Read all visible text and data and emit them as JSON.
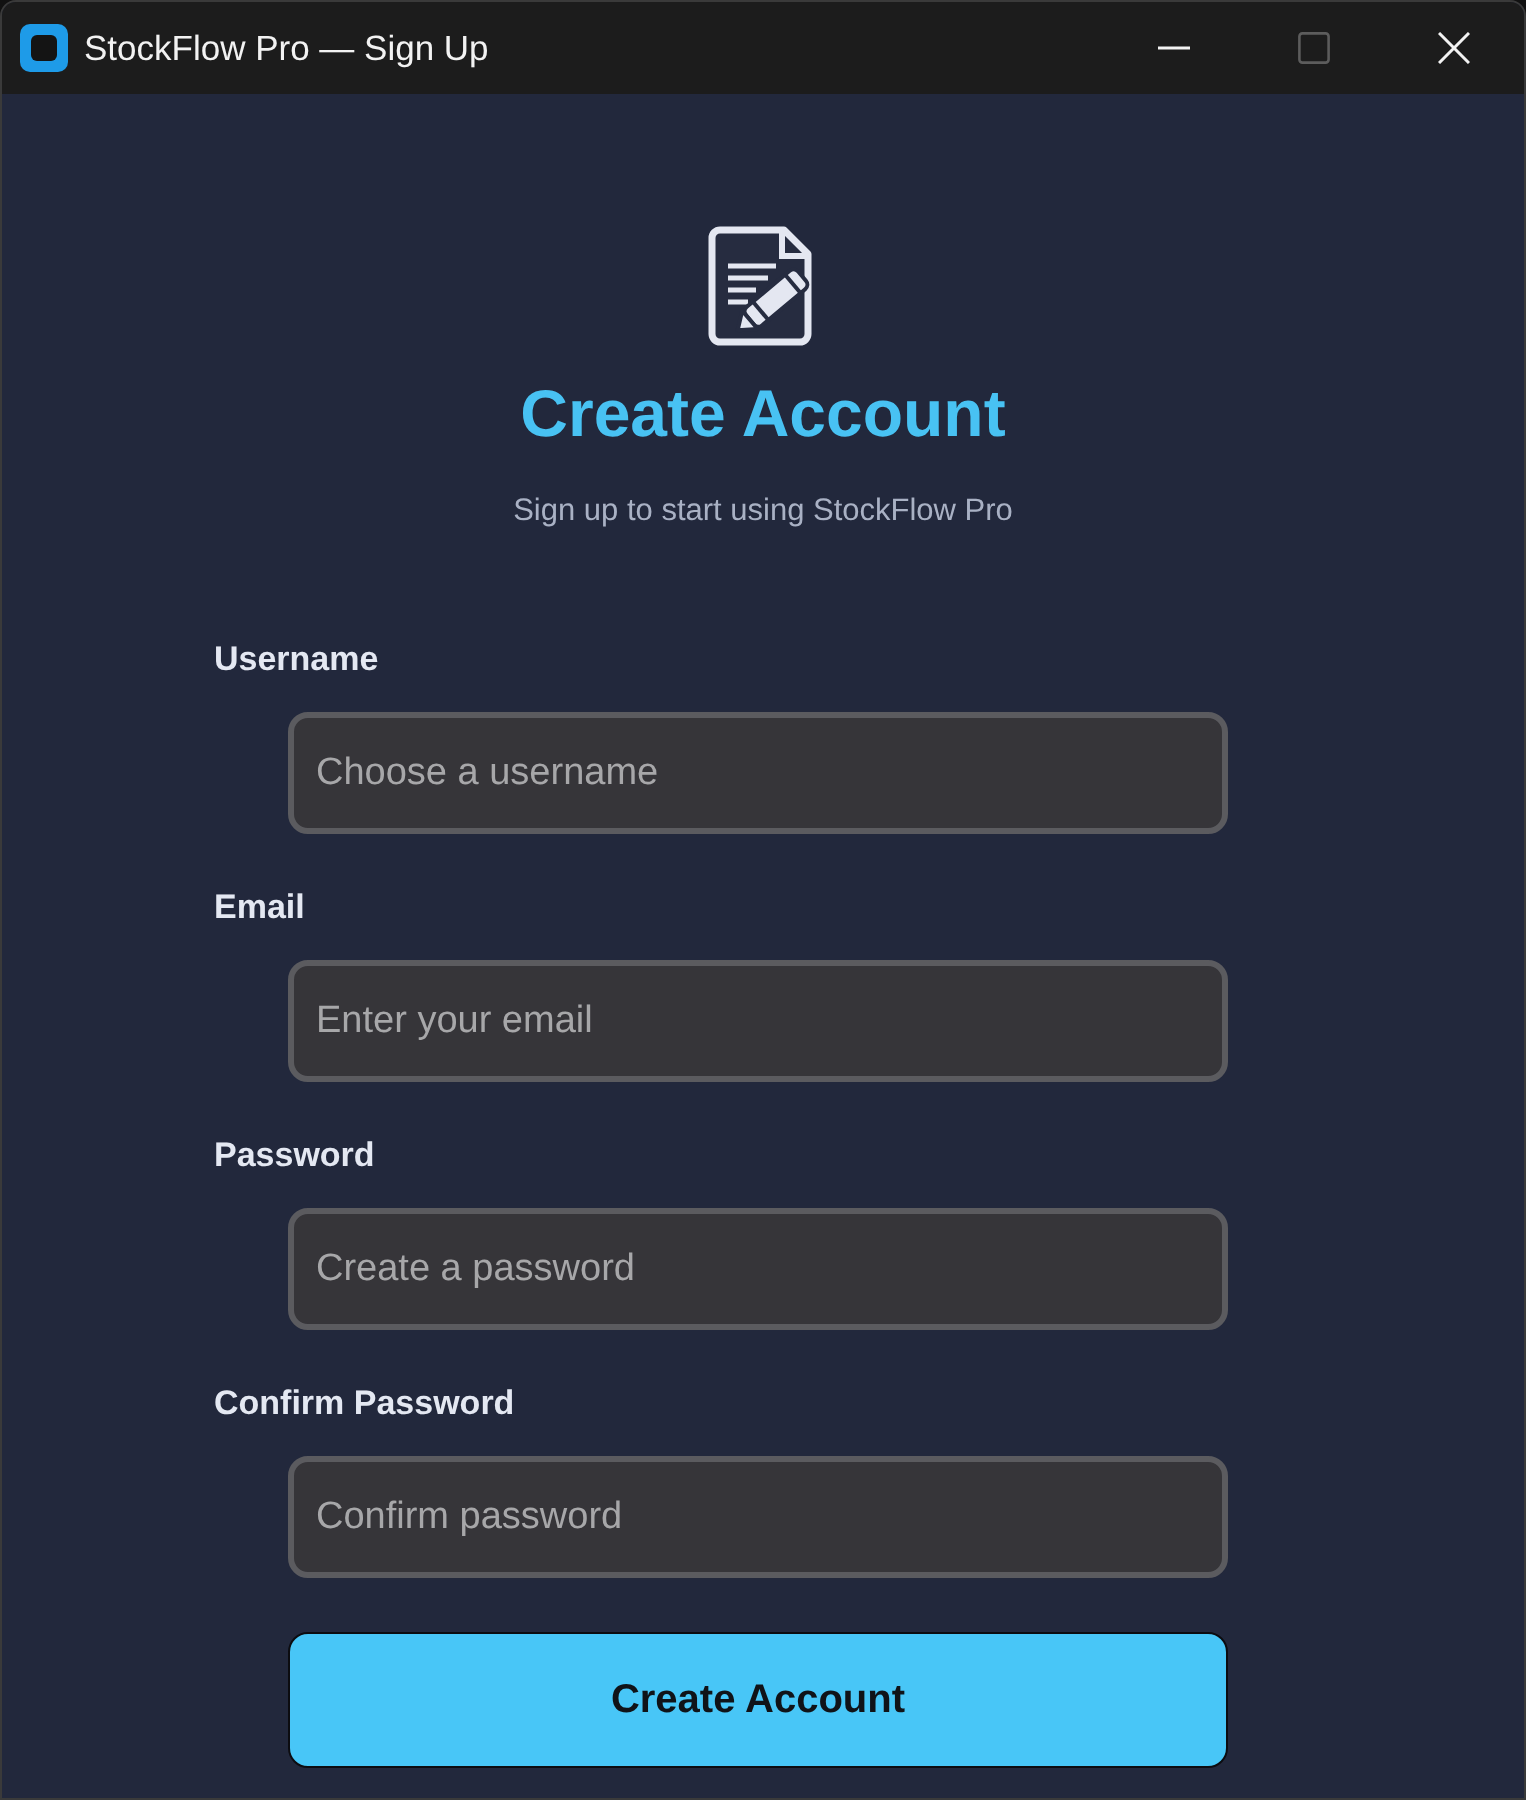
{
  "window": {
    "title": "StockFlow Pro — Sign Up",
    "controls": [
      {
        "kind": "minimize",
        "disabled": false
      },
      {
        "kind": "maximize",
        "disabled": true
      },
      {
        "kind": "close",
        "disabled": false
      }
    ]
  },
  "header": {
    "title": "Create Account",
    "subtitle": "Sign up to start using StockFlow Pro"
  },
  "fields": [
    {
      "label": "Username",
      "placeholder": "Choose a username"
    },
    {
      "label": "Email",
      "placeholder": "Enter your email"
    },
    {
      "label": "Password",
      "placeholder": "Create a password"
    },
    {
      "label": "Confirm Password",
      "placeholder": "Confirm password"
    }
  ],
  "submit": {
    "label": "Create Account"
  }
}
